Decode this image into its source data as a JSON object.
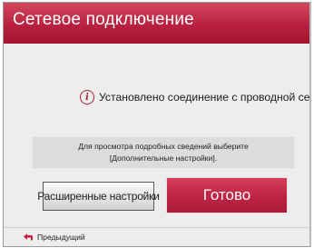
{
  "dialog": {
    "title": "Сетевое подключение",
    "status_icon": "info-icon",
    "status_text": "Установлено соединение с проводной сетью.",
    "details_line1": "Для просмотра подробных сведений выберите",
    "details_line2": "[Дополнительные настройки].",
    "advanced_button_label": "Расширенные настройки",
    "done_button_label": "Готово",
    "back_icon": "back-arrow-icon",
    "back_label": "Предыдущий"
  },
  "colors": {
    "title_bar": "#b8213f",
    "done_button": "#c02646",
    "back_icon": "#c51f3e"
  }
}
